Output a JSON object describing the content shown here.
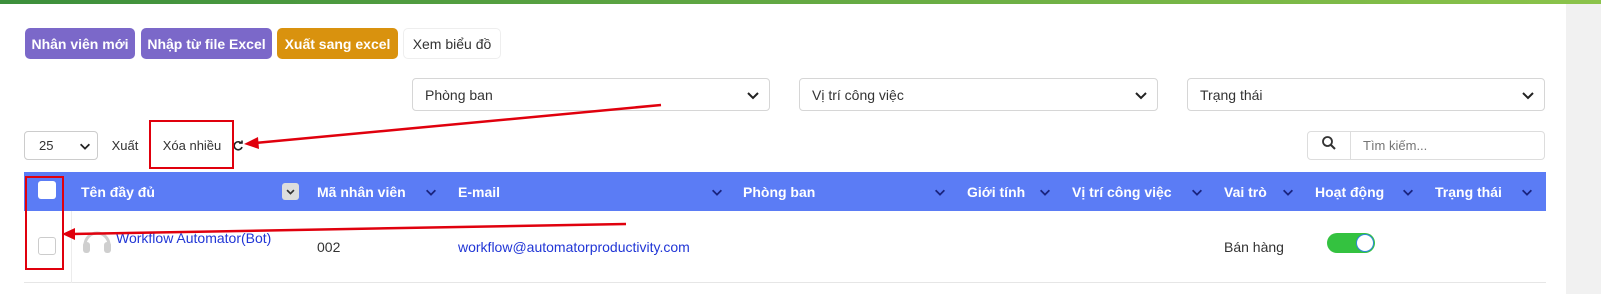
{
  "actions": {
    "new_employee": "Nhân viên mới",
    "import_excel": "Nhập từ file Excel",
    "export_excel": "Xuất sang excel",
    "view_chart": "Xem biểu đồ"
  },
  "filters": {
    "department": "Phòng ban",
    "job_position": "Vị trí công việc",
    "status": "Trạng thái"
  },
  "toolbar": {
    "page_size": "25",
    "export_label": "Xuất",
    "bulk_delete_label": "Xóa nhiều"
  },
  "search": {
    "placeholder": "Tìm kiếm..."
  },
  "table": {
    "columns": [
      "Tên đầy đủ",
      "Mã nhân viên",
      "E-mail",
      "Phòng ban",
      "Giới tính",
      "Vị trí công việc",
      "Vai trò",
      "Hoạt động",
      "Trạng thái"
    ],
    "rows": [
      {
        "full_name": "Workflow Automator(Bot)",
        "employee_code": "002",
        "email": "workflow@automatorproductivity.com",
        "department": "",
        "gender": "",
        "job_position": "",
        "role": "Bán hàng",
        "active": true,
        "status": ""
      }
    ]
  },
  "colors": {
    "header_bg": "#5b7cf5",
    "purple_button": "#7b68c9",
    "orange_button": "#d9920e",
    "toggle_on": "#34c240",
    "annotation_red": "#e0000d"
  },
  "icons": [
    "chevron-down-icon",
    "refresh-icon",
    "search-icon",
    "avatar-icon",
    "sort-icon"
  ]
}
